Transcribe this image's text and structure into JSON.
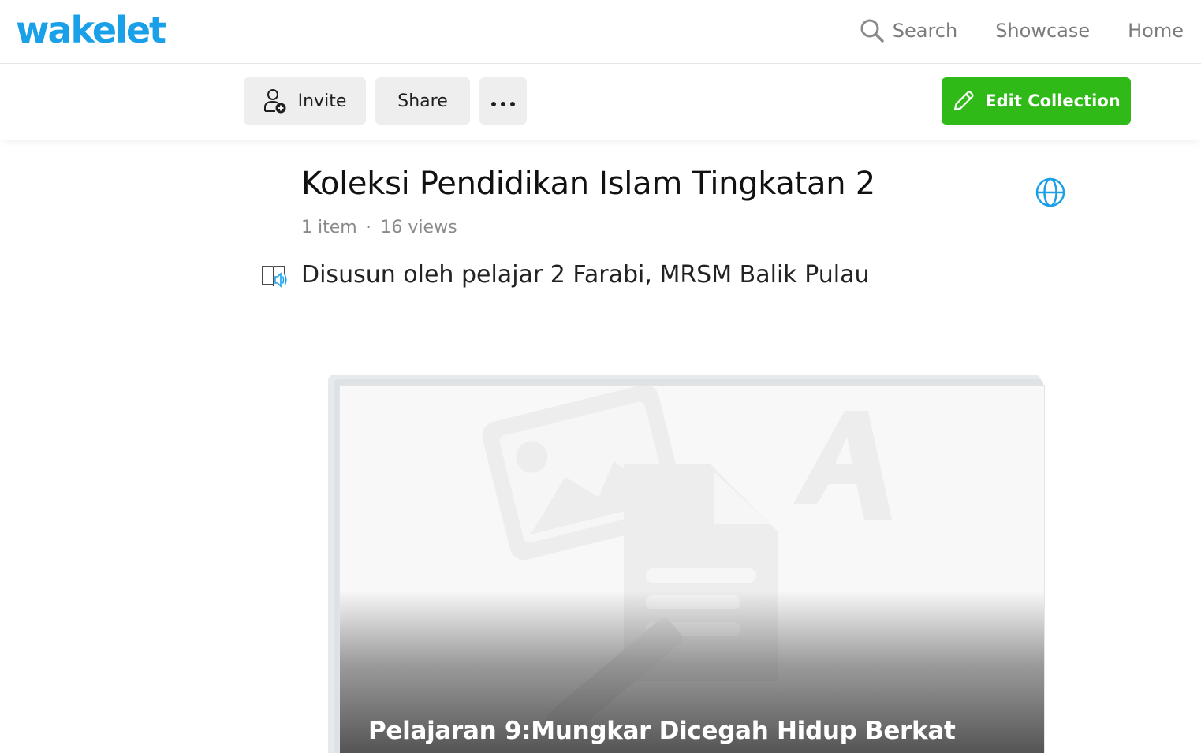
{
  "brand": {
    "logo_text": "wakelet",
    "accent": "#1aa0e8"
  },
  "nav": {
    "search_label": "Search",
    "showcase_label": "Showcase",
    "home_label": "Home"
  },
  "toolbar": {
    "invite_label": "Invite",
    "share_label": "Share",
    "edit_label": "Edit Collection",
    "edit_color": "#2fba18"
  },
  "collection": {
    "title": "Koleksi Pendidikan Islam Tingkatan 2",
    "item_count": "1 item",
    "separator": "·",
    "views": "16 views",
    "description": "Disusun oleh pelajar 2 Farabi, MRSM Balik Pulau"
  },
  "items": [
    {
      "title": "Pelajaran 9:Mungkar Dicegah Hidup Berkat"
    }
  ],
  "icons": {
    "search": "search-icon",
    "invite": "add-person-icon",
    "more": "more-dots-icon",
    "edit": "pencil-icon",
    "visibility": "globe-icon",
    "reader": "immersive-reader-icon"
  }
}
